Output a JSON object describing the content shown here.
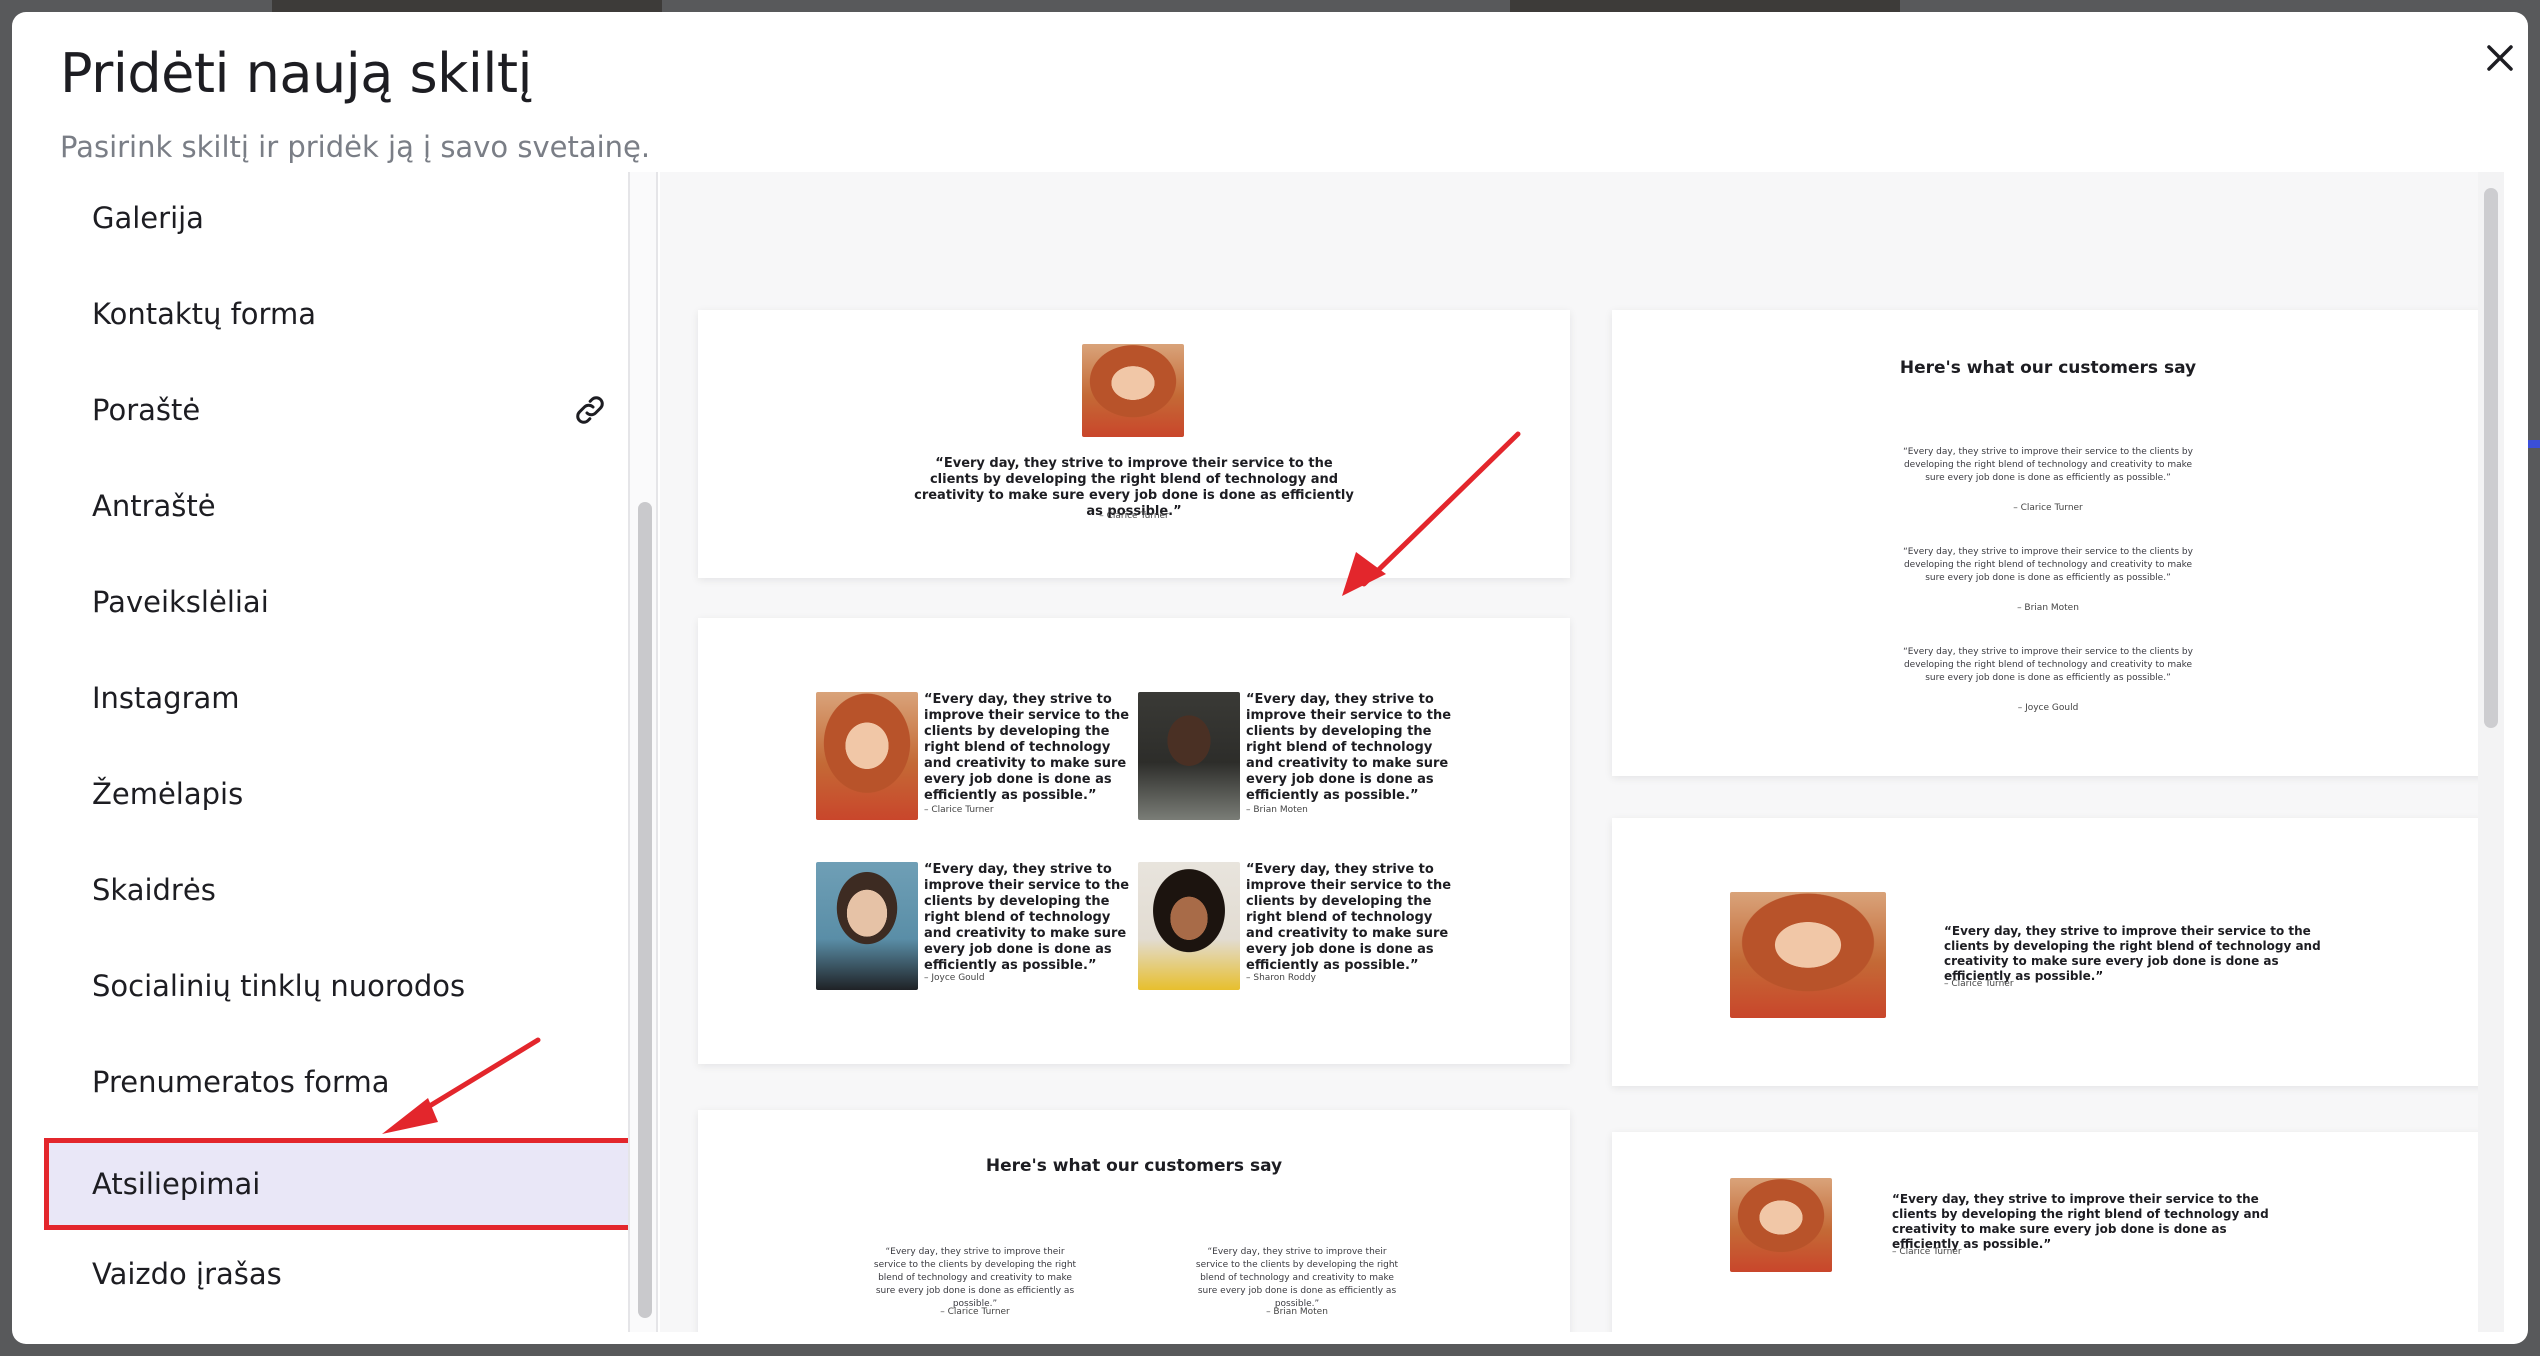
{
  "modal": {
    "title": "Pridėti naują skiltį",
    "subtitle": "Pasirink skiltį ir pridėk ją į savo svetainę."
  },
  "sidebar": {
    "items": [
      {
        "label": "Galerija"
      },
      {
        "label": "Kontaktų forma"
      },
      {
        "label": "Poraštė",
        "icon": "link-icon"
      },
      {
        "label": "Antraštė"
      },
      {
        "label": "Paveikslėliai"
      },
      {
        "label": "Instagram"
      },
      {
        "label": "Žemėlapis"
      },
      {
        "label": "Skaidrės"
      },
      {
        "label": "Socialinių tinklų nuorodos"
      },
      {
        "label": "Prenumeratos forma"
      },
      {
        "label": "Atsiliepimai",
        "selected": true
      },
      {
        "label": "Vaizdo įrašas"
      }
    ]
  },
  "previews": {
    "quote": "“Every day, they strive to improve their service to the clients by developing the right blend of technology and creativity to make sure every job done is done as efficiently as possible.”",
    "heading": "Here's what our customers say",
    "authors": {
      "clarice": "– Clarice Turner",
      "brian": "– Brian Moten",
      "joyce": "– Joyce Gould",
      "sharon": "– Sharon Roddy"
    }
  },
  "colors": {
    "highlight_border": "#e3262c",
    "selected_bg": "#e9e7f7",
    "arrow": "#e3262c"
  }
}
